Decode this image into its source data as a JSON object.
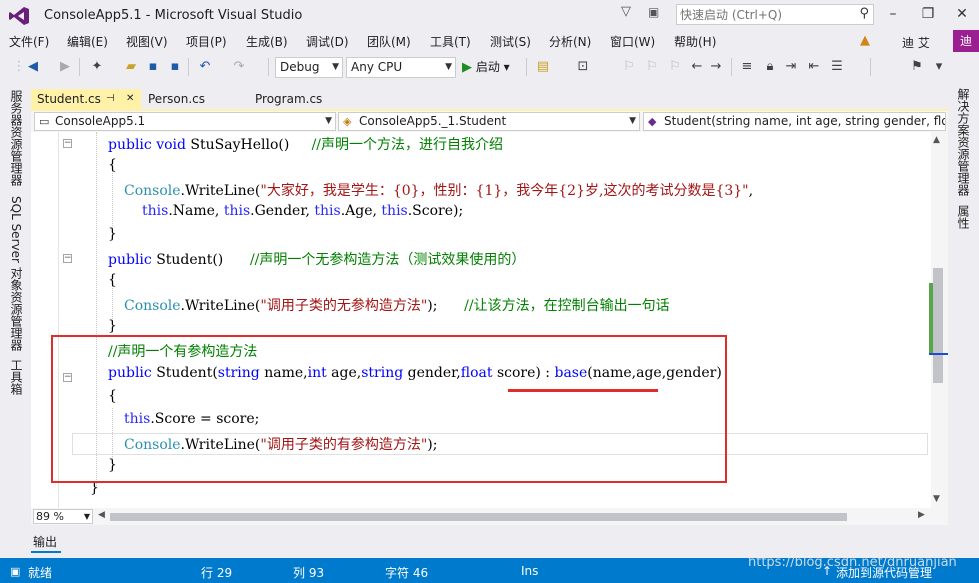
{
  "window": {
    "title": "ConsoleApp5.1 - Microsoft Visual Studio",
    "quick_launch_placeholder": "快速启动 (Ctrl+Q)"
  },
  "menu": [
    "文件(F)",
    "编辑(E)",
    "视图(V)",
    "项目(P)",
    "生成(B)",
    "调试(D)",
    "团队(M)",
    "工具(T)",
    "测试(S)",
    "分析(N)",
    "窗口(W)",
    "帮助(H)"
  ],
  "user": {
    "name": "迪 艾",
    "avatar": "迪"
  },
  "toolbar": {
    "config": "Debug",
    "platform": "Any CPU",
    "run_label": "启动"
  },
  "left_panels": [
    "服务器资源管理器",
    "SQL Server 对象资源管理器",
    "工具箱"
  ],
  "right_panels": [
    "解决方案资源管理器",
    "属性"
  ],
  "tabs": [
    "Student.cs",
    "Person.cs",
    "Program.cs"
  ],
  "nav": {
    "project": "ConsoleApp5.1",
    "class": "ConsoleApp5._1.Student",
    "member": "Student(string name, int age, string gender, float score)"
  },
  "editor": {
    "zoom": "89 %",
    "code": {
      "l1_kw": "public",
      "l1_kw2": "void",
      "l1_name": " StuSayHello()",
      "l1_cmt": "//声明一个方法，进行自我介绍",
      "l2": "{",
      "l3_ty": "Console",
      "l3_mid": ".WriteLine(",
      "l3_str": "\"大家好，我是学生：{0}，性别：{1}，我今年{2}岁,这次的考试分数是{3}\"",
      "l3_end": ",",
      "l4_this1": "this",
      "l4_a": ".Name, ",
      "l4_this2": "this",
      "l4_b": ".Gender, ",
      "l4_this3": "this",
      "l4_c": ".Age, ",
      "l4_this4": "this",
      "l4_d": ".Score);",
      "l5": "}",
      "l6_kw": "public",
      "l6_name": " Student()",
      "l6_cmt": "//声明一个无参构造方法（测试效果使用的）",
      "l7": "{",
      "l8_ty": "Console",
      "l8_mid": ".WriteLine(",
      "l8_str": "\"调用子类的无参构造方法\"",
      "l8_end": ");",
      "l8_cmt": "//让该方法，在控制台输出一句话",
      "l9": "}",
      "l10_cmt": "//声明一个有参构造方法",
      "l11_kw": "public",
      "l11_a": " Student(",
      "l11_s1": "string",
      "l11_b": " name,",
      "l11_i": "int",
      "l11_c": " age,",
      "l11_s2": "string",
      "l11_d": " gender,",
      "l11_f": "float",
      "l11_e": " score) : ",
      "l11_base": "base",
      "l11_g": "(name,age,gender)",
      "l12": "{",
      "l13_this": "this",
      "l13_rest": ".Score = score;",
      "l14_ty": "Console",
      "l14_mid": ".WriteLine(",
      "l14_str": "\"调用子类的有参构造方法\"",
      "l14_end": ");",
      "l15": "}",
      "l16": "}"
    }
  },
  "output_tab": "输出",
  "status": {
    "ready": "就绪",
    "line": "行 29",
    "col": "列 93",
    "char": "字符 46",
    "mode": "Ins",
    "source_control": "添加到源代码管理"
  },
  "watermark": "https://blog.csdn.net/dnruanjian",
  "colors": {
    "status_bar": "#007acc",
    "active_tab": "#fff1a8",
    "highlight_box": "#e12c2c"
  }
}
